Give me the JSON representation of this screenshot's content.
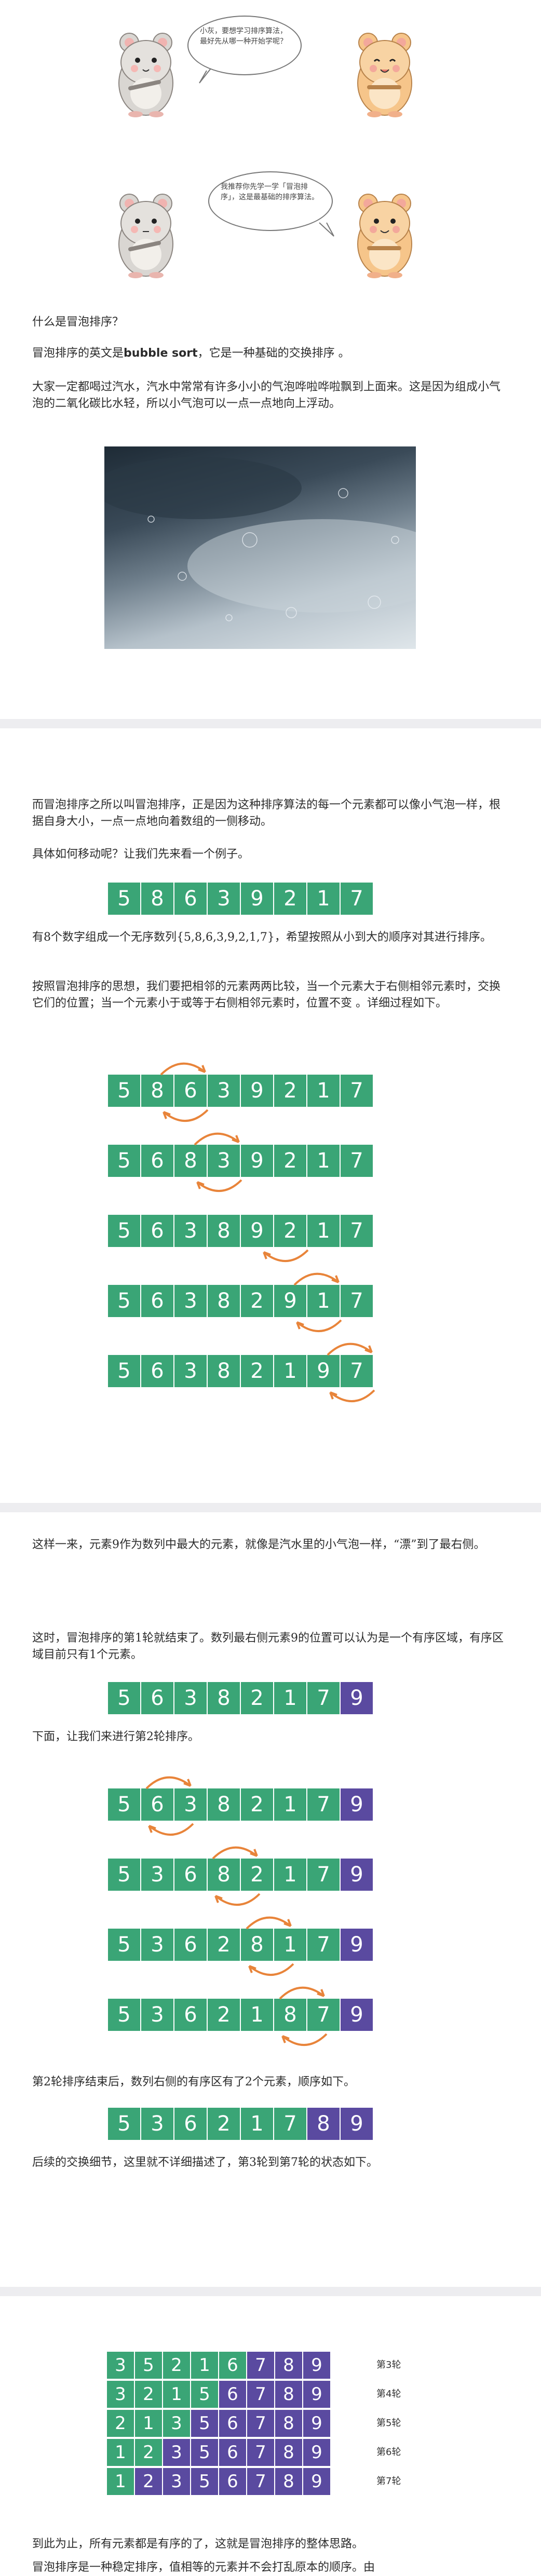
{
  "illustration": {
    "bubble1": "小灰，要想学习排序算法，最好先从哪一种开始学呢？",
    "bubble2": "我推荐你先学一学「冒泡排序」，这是最基础的排序算法。"
  },
  "section1": {
    "heading": "什么是冒泡排序？",
    "p1_prefix": "冒泡排序的英文是",
    "p1_bold": "bubble sort",
    "p1_suffix": "，它是一种基础的交换排序 。",
    "p2": "大家一定都喝过汽水，汽水中常常有许多小小的气泡哗啦哗啦飘到上面来。这是因为组成小气泡的二氧化碳比水轻，所以小气泡可以一点一点地向上浮动。"
  },
  "section2": {
    "p1": "而冒泡排序之所以叫冒泡排序，正是因为这种排序算法的每一个元素都可以像小气泡一样，根据自身大小，一点一点地向着数组的一侧移动。",
    "p2": "具体如何移动呢？让我们先来看一个例子。",
    "p3": "有8个数字组成一个无序数列{5,8,6,3,9,2,1,7}，希望按照从小到大的顺序对其进行排序。",
    "p4": "按照冒泡排序的思想，我们要把相邻的元素两两比较，当一个元素大于右侧相邻元素时，交换它们的位置；当一个元素小于或等于右侧相邻元素时，位置不变 。详细过程如下。"
  },
  "section3": {
    "p1": "这样一来，元素9作为数列中最大的元素，就像是汽水里的小气泡一样，“漂”到了最右侧。",
    "p2": "这时，冒泡排序的第1轮就结束了。数列最右侧元素9的位置可以认为是一个有序区域，有序区域目前只有1个元素。",
    "p3": "下面，让我们来进行第2轮排序。",
    "p4": "第2轮排序结束后，数列右侧的有序区有了2个元素，顺序如下。",
    "p5": "后续的交换细节，这里就不详细描述了，第3轮到第7轮的状态如下。"
  },
  "section4": {
    "rounds": [
      {
        "label": "第3轮",
        "values": [
          "3",
          "5",
          "2",
          "1",
          "6",
          "7",
          "8",
          "9"
        ],
        "sorted_from": 5
      },
      {
        "label": "第4轮",
        "values": [
          "3",
          "2",
          "1",
          "5",
          "6",
          "7",
          "8",
          "9"
        ],
        "sorted_from": 4
      },
      {
        "label": "第5轮",
        "values": [
          "2",
          "1",
          "3",
          "5",
          "6",
          "7",
          "8",
          "9"
        ],
        "sorted_from": 3
      },
      {
        "label": "第6轮",
        "values": [
          "1",
          "2",
          "3",
          "5",
          "6",
          "7",
          "8",
          "9"
        ],
        "sorted_from": 2
      },
      {
        "label": "第7轮",
        "values": [
          "1",
          "2",
          "3",
          "5",
          "6",
          "7",
          "8",
          "9"
        ],
        "sorted_from": 1
      }
    ],
    "p1": "到此为止，所有元素都是有序的了，这就是冒泡排序的整体思路。",
    "p2": "冒泡排序是一种稳定排序，值相等的元素并不会打乱原本的顺序。由"
  },
  "rows": {
    "initial": {
      "values": [
        "5",
        "8",
        "6",
        "3",
        "9",
        "2",
        "1",
        "7"
      ],
      "sorted_from": 8
    },
    "step1": {
      "values": [
        "5",
        "8",
        "6",
        "3",
        "9",
        "2",
        "1",
        "7"
      ],
      "sorted_from": 8
    },
    "step2": {
      "values": [
        "5",
        "6",
        "8",
        "3",
        "9",
        "2",
        "1",
        "7"
      ],
      "sorted_from": 8
    },
    "step3": {
      "values": [
        "5",
        "6",
        "3",
        "8",
        "9",
        "2",
        "1",
        "7"
      ],
      "sorted_from": 8
    },
    "step4": {
      "values": [
        "5",
        "6",
        "3",
        "8",
        "2",
        "9",
        "1",
        "7"
      ],
      "sorted_from": 8
    },
    "step5": {
      "values": [
        "5",
        "6",
        "3",
        "8",
        "2",
        "1",
        "9",
        "7"
      ],
      "sorted_from": 8
    },
    "after_round1": {
      "values": [
        "5",
        "6",
        "3",
        "8",
        "2",
        "1",
        "7",
        "9"
      ],
      "sorted_from": 7
    },
    "r2_step1": {
      "values": [
        "5",
        "6",
        "3",
        "8",
        "2",
        "1",
        "7",
        "9"
      ],
      "sorted_from": 7
    },
    "r2_step2": {
      "values": [
        "5",
        "3",
        "6",
        "8",
        "2",
        "1",
        "7",
        "9"
      ],
      "sorted_from": 7
    },
    "r2_step3": {
      "values": [
        "5",
        "3",
        "6",
        "2",
        "8",
        "1",
        "7",
        "9"
      ],
      "sorted_from": 7
    },
    "r2_step4": {
      "values": [
        "5",
        "3",
        "6",
        "2",
        "1",
        "8",
        "7",
        "9"
      ],
      "sorted_from": 7
    },
    "after_round2": {
      "values": [
        "5",
        "3",
        "6",
        "2",
        "1",
        "7",
        "8",
        "9"
      ],
      "sorted_from": 6
    }
  },
  "colors": {
    "unsorted": "#3aa576",
    "sorted": "#5a4aa0",
    "arrow": "#e8843a",
    "separator": "#ededf0"
  }
}
